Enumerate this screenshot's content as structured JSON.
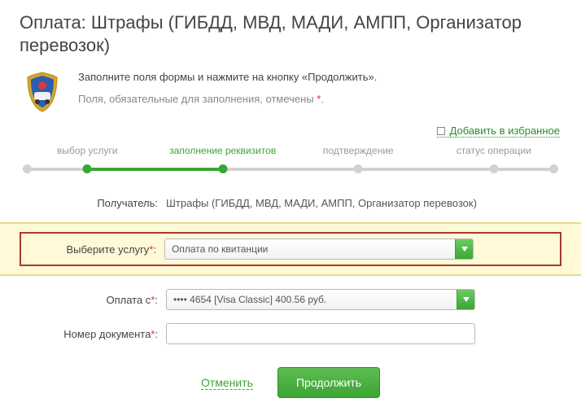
{
  "page_title": "Оплата: Штрафы (ГИБДД, МВД, МАДИ, АМПП, Организатор перевозок)",
  "intro": {
    "line1": "Заполните поля формы и нажмите на кнопку «Продолжить».",
    "line2_prefix": "Поля, обязательные для заполнения, отмечены ",
    "asterisk": "*",
    "line2_suffix": "."
  },
  "favorite_link": "Добавить в избранное",
  "progress": {
    "steps": [
      "выбор услуги",
      "заполнение реквизитов",
      "подтверждение",
      "статус операции"
    ],
    "active_index": 1
  },
  "form": {
    "recipient_label": "Получатель:",
    "recipient_value": "Штрафы (ГИБДД, МВД, МАДИ, АМПП, Организатор перевозок)",
    "service_label": "Выберите услугу",
    "service_value": "Оплата по квитанции",
    "pay_from_label": "Оплата с",
    "pay_from_value": "•••• 4654 [Visa Classic] 400.56 руб.",
    "doc_label": "Номер документа",
    "doc_value": ""
  },
  "actions": {
    "cancel": "Отменить",
    "continue": "Продолжить"
  }
}
